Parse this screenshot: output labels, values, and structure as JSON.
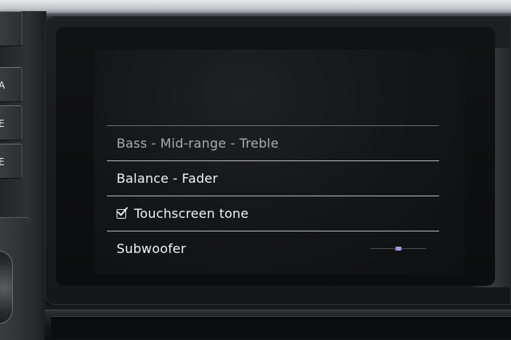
{
  "hardware": {
    "buttons": [
      {
        "label": "A"
      },
      {
        "label": "E"
      },
      {
        "label": "E"
      }
    ]
  },
  "menu": {
    "items": [
      {
        "label": "Bass - Mid-range - Treble",
        "enabled": false
      },
      {
        "label": "Balance - Fader",
        "enabled": true
      },
      {
        "label": "Touchscreen tone",
        "checked": true
      },
      {
        "label": "Subwoofer",
        "slider_level": 0.5
      }
    ]
  },
  "colors": {
    "text": "#f2f2f2",
    "text_dim": "#a9acb0",
    "divider": "#cfd2d6",
    "screen_bg": "#141517",
    "slider_accent": "#9c8de0"
  }
}
